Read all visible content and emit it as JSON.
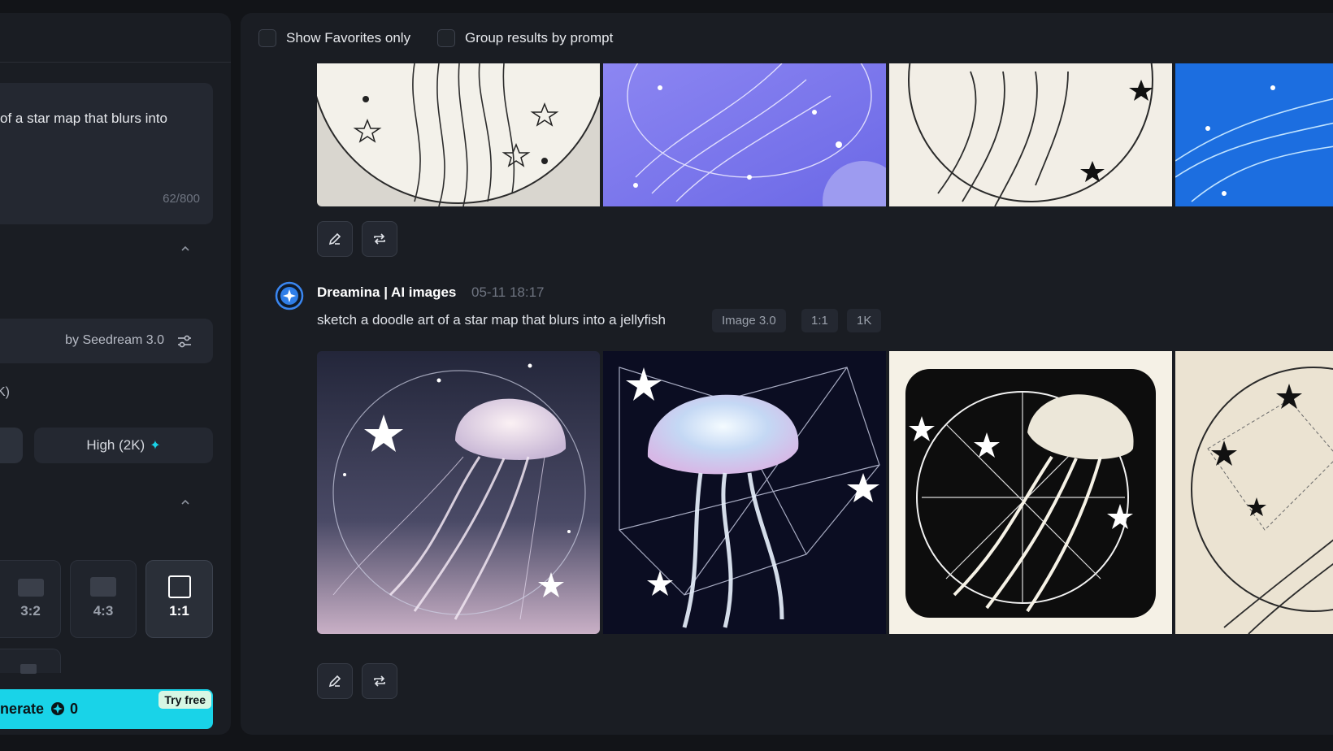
{
  "left_panel": {
    "prompt_text": "of a star map that blurs into",
    "char_count": "62/800",
    "model_label": "by Seedream 3.0",
    "resolution_label": "K)",
    "resolution_high": "High (2K)",
    "aspect_ratios": [
      "3:2",
      "4:3",
      "1:1"
    ],
    "selected_ratio": "1:1",
    "generate_label": "nerate",
    "credit_count": "0",
    "try_free": "Try free"
  },
  "filters": {
    "favorites_label": "Show Favorites only",
    "group_label": "Group results by prompt"
  },
  "result": {
    "author": "Dreamina | AI images",
    "timestamp": "05-11   18:17",
    "prompt": "sketch a doodle art of a star map that blurs into a jellyfish",
    "tags": [
      "Image 3.0",
      "1:1",
      "1K"
    ]
  },
  "colors": {
    "accent": "#19d3e8",
    "panel": "#1a1d23",
    "background": "#121418"
  }
}
